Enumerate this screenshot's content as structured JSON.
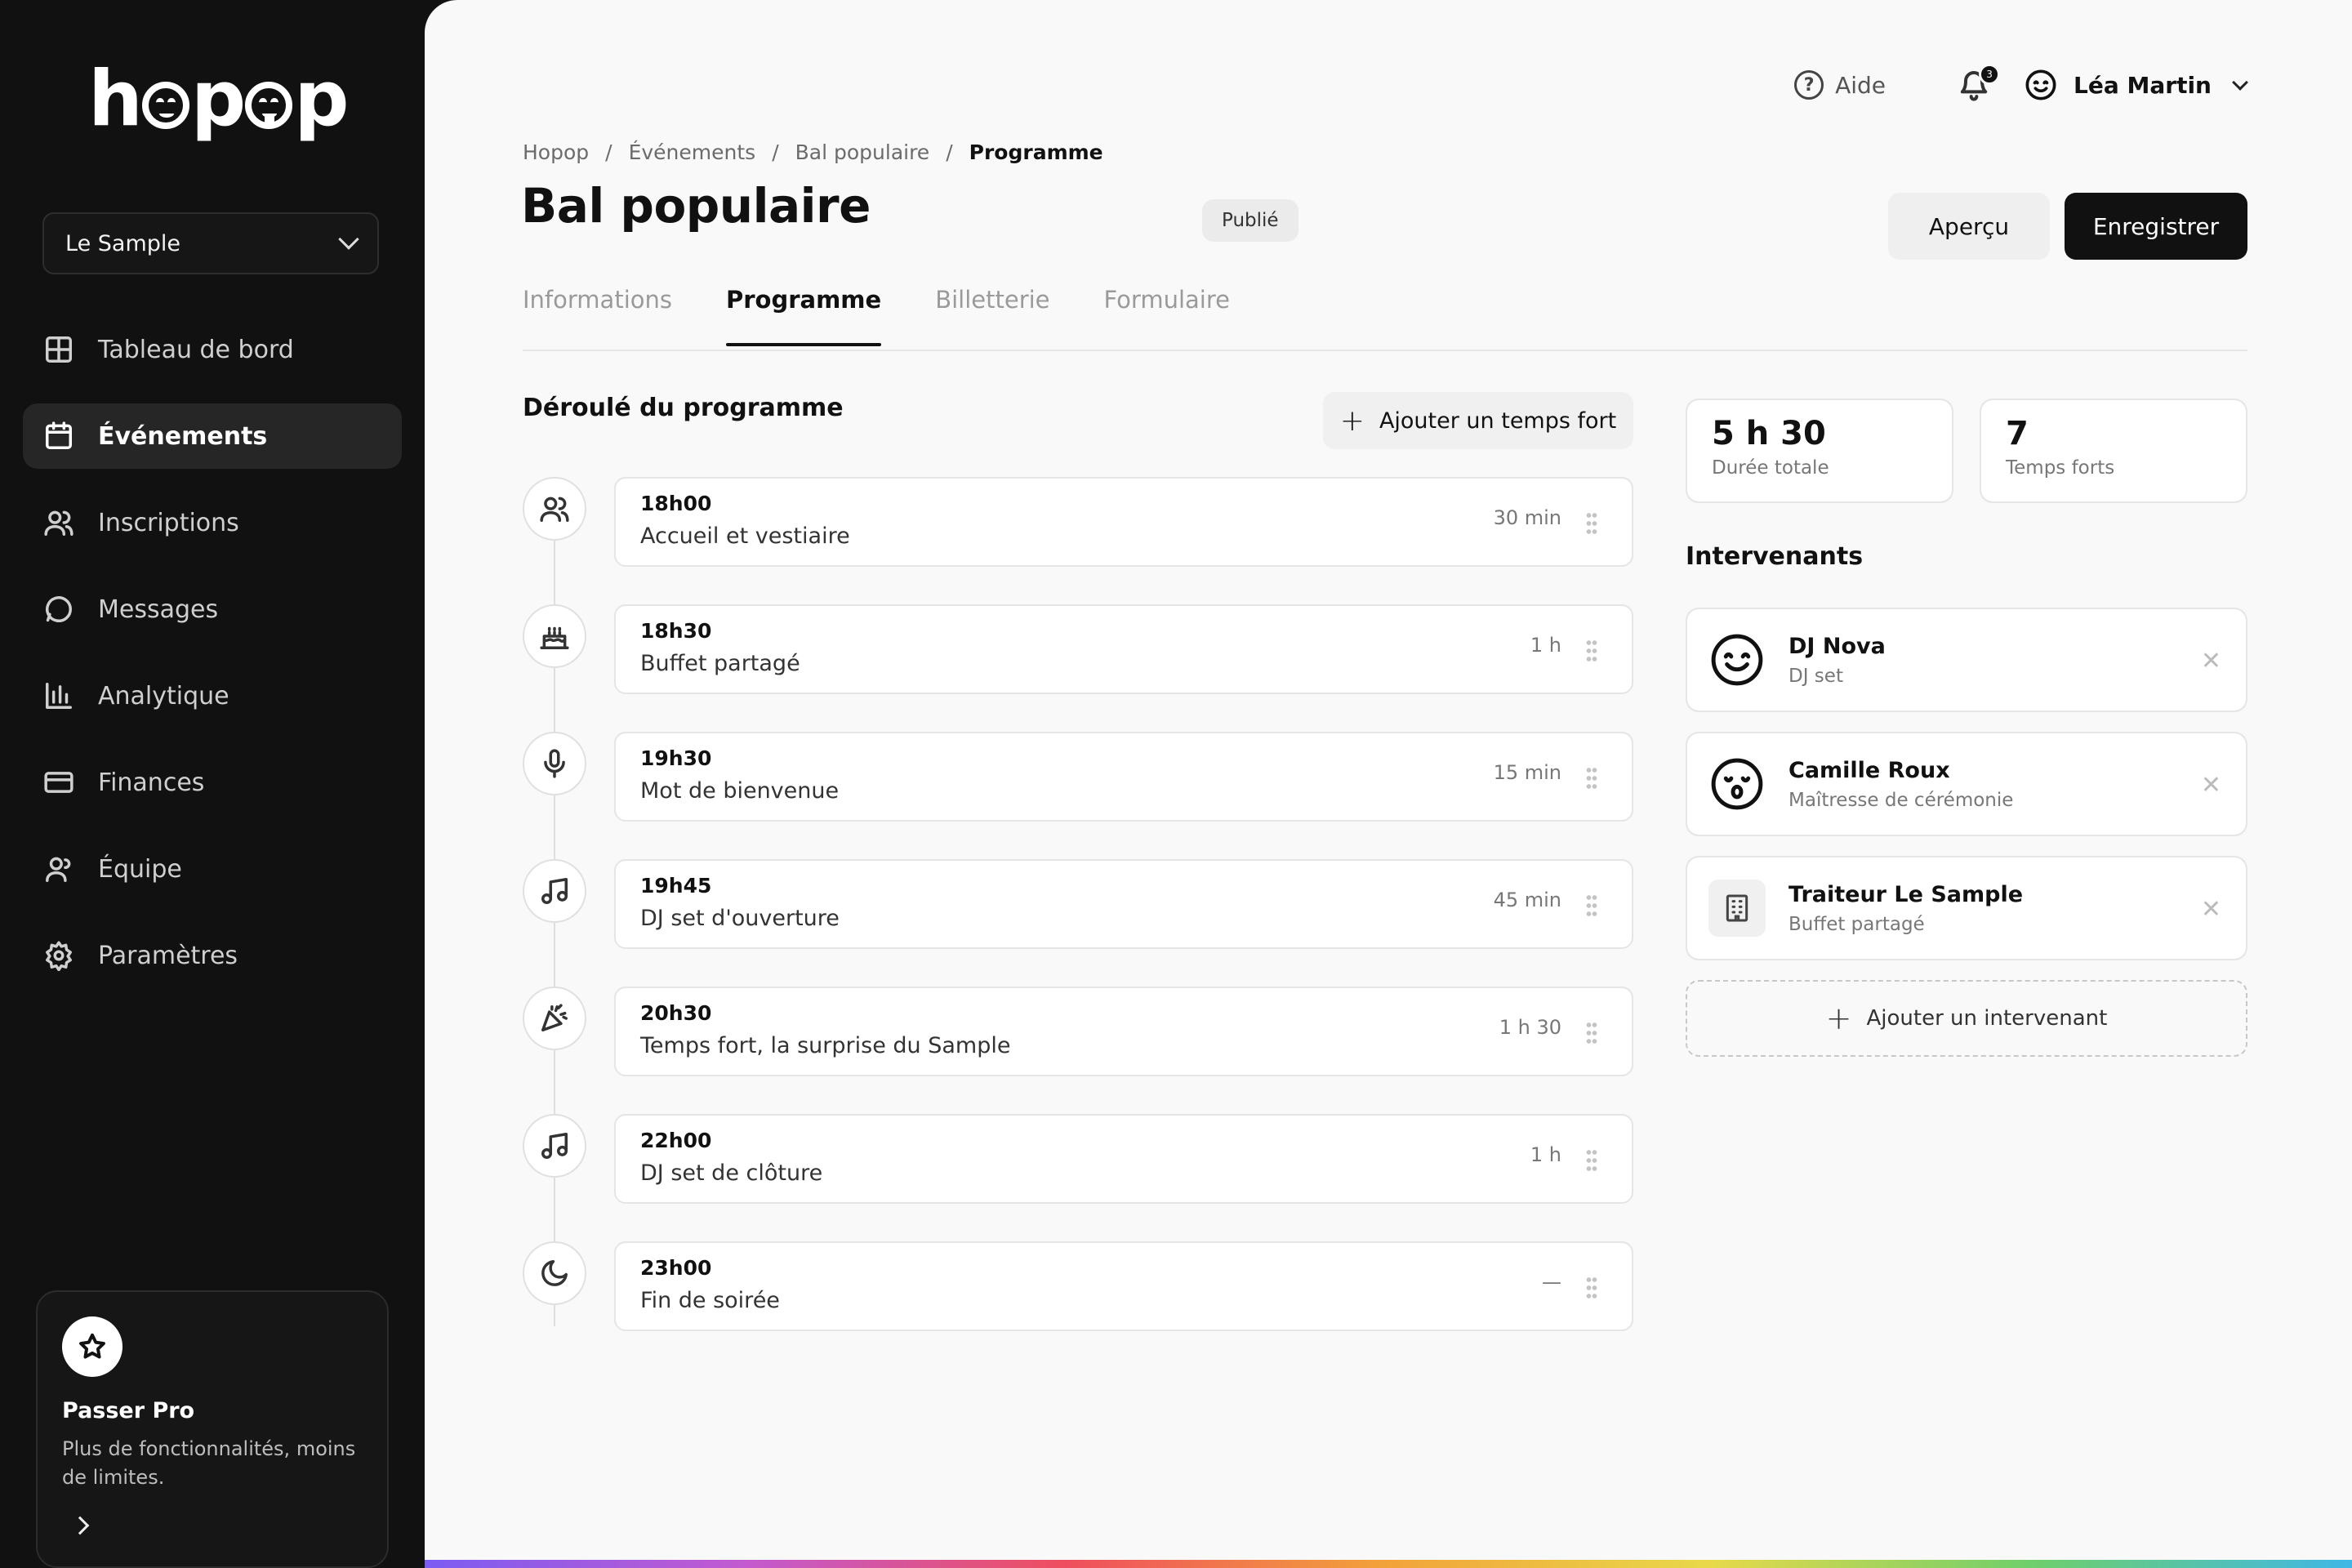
{
  "brand": {
    "logo_text": "hopop"
  },
  "sidebar": {
    "org": "Le Sample",
    "items": [
      {
        "label": "Tableau de bord",
        "icon": "dashboard-icon"
      },
      {
        "label": "Événements",
        "icon": "calendar-icon",
        "active": true
      },
      {
        "label": "Inscriptions",
        "icon": "users-icon"
      },
      {
        "label": "Messages",
        "icon": "message-icon"
      },
      {
        "label": "Analytique",
        "icon": "chart-icon"
      },
      {
        "label": "Finances",
        "icon": "card-icon"
      },
      {
        "label": "Équipe",
        "icon": "team-icon"
      },
      {
        "label": "Paramètres",
        "icon": "gear-icon"
      }
    ],
    "promo": {
      "title": "Passer Pro",
      "desc": "Plus de fonctionnalités, moins de limites."
    }
  },
  "topbar": {
    "help": "Aide",
    "notifications": "3",
    "user": "Léa Martin"
  },
  "breadcrumb": [
    "Hopop",
    "Événements",
    "Bal populaire",
    "Programme"
  ],
  "page": {
    "title": "Bal populaire",
    "status": "Publié",
    "preview": "Aperçu",
    "save": "Enregistrer"
  },
  "tabs": [
    "Informations",
    "Programme",
    "Billetterie",
    "Formulaire"
  ],
  "programme": {
    "title": "Déroulé du programme",
    "add": "Ajouter un temps fort",
    "items": [
      {
        "time": "18h00",
        "name": "Accueil et vestiaire",
        "duration": "30 min",
        "icon": "users-icon"
      },
      {
        "time": "18h30",
        "name": "Buffet partagé",
        "duration": "1 h",
        "icon": "cake-icon"
      },
      {
        "time": "19h30",
        "name": "Mot de bienvenue",
        "duration": "15 min",
        "icon": "microphone-icon"
      },
      {
        "time": "19h45",
        "name": "DJ set d'ouverture",
        "duration": "45 min",
        "icon": "music-icon"
      },
      {
        "time": "20h30",
        "name": "Temps fort, la surprise du Sample",
        "duration": "1 h 30",
        "icon": "party-icon"
      },
      {
        "time": "22h00",
        "name": "DJ set de clôture",
        "duration": "1 h",
        "icon": "music-icon"
      },
      {
        "time": "23h00",
        "name": "Fin de soirée",
        "duration": "—",
        "icon": "moon-icon"
      }
    ]
  },
  "stats": [
    {
      "value": "5 h 30",
      "label": "Durée totale"
    },
    {
      "value": "7",
      "label": "Temps forts"
    }
  ],
  "speakers": {
    "title": "Intervenants",
    "items": [
      {
        "name": "DJ Nova",
        "role": "DJ set",
        "icon": "smile-icon"
      },
      {
        "name": "Camille Roux",
        "role": "Maîtresse de cérémonie",
        "icon": "kiss-face-icon"
      },
      {
        "name": "Traiteur Le Sample",
        "role": "Buffet partagé",
        "icon": "building-icon"
      }
    ],
    "add": "Ajouter un intervenant"
  }
}
